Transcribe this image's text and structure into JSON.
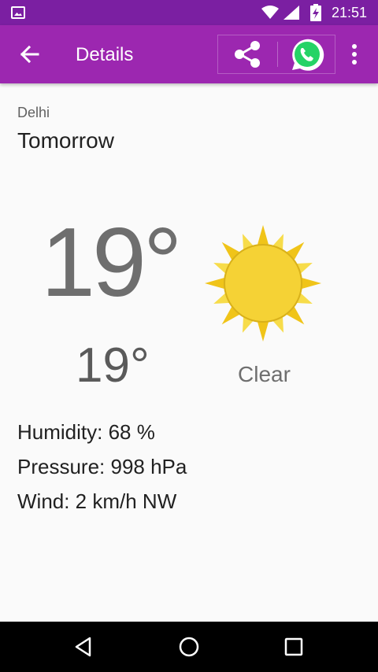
{
  "status_bar": {
    "time": "21:51",
    "icons": [
      "gallery-icon",
      "wifi-icon",
      "signal-icon",
      "battery-charging-icon"
    ]
  },
  "app_bar": {
    "title": "Details",
    "icons": [
      "back-arrow-icon",
      "share-icon",
      "whatsapp-icon",
      "overflow-menu-icon"
    ]
  },
  "forecast": {
    "city": "Delhi",
    "day": "Tomorrow",
    "high": "19°",
    "low": "19°",
    "condition": "Clear",
    "icon": "sun-icon",
    "humidity": "Humidity: 68 %",
    "pressure": "Pressure: 998 hPa",
    "wind": "Wind: 2 km/h NW"
  },
  "nav_bar": {
    "icons": [
      "nav-back-icon",
      "nav-home-icon",
      "nav-recents-icon"
    ]
  },
  "colors": {
    "status_bar": "#7b1fa2",
    "app_bar": "#9c27b0",
    "sun": "#f5d235",
    "whatsapp": "#25d366"
  }
}
